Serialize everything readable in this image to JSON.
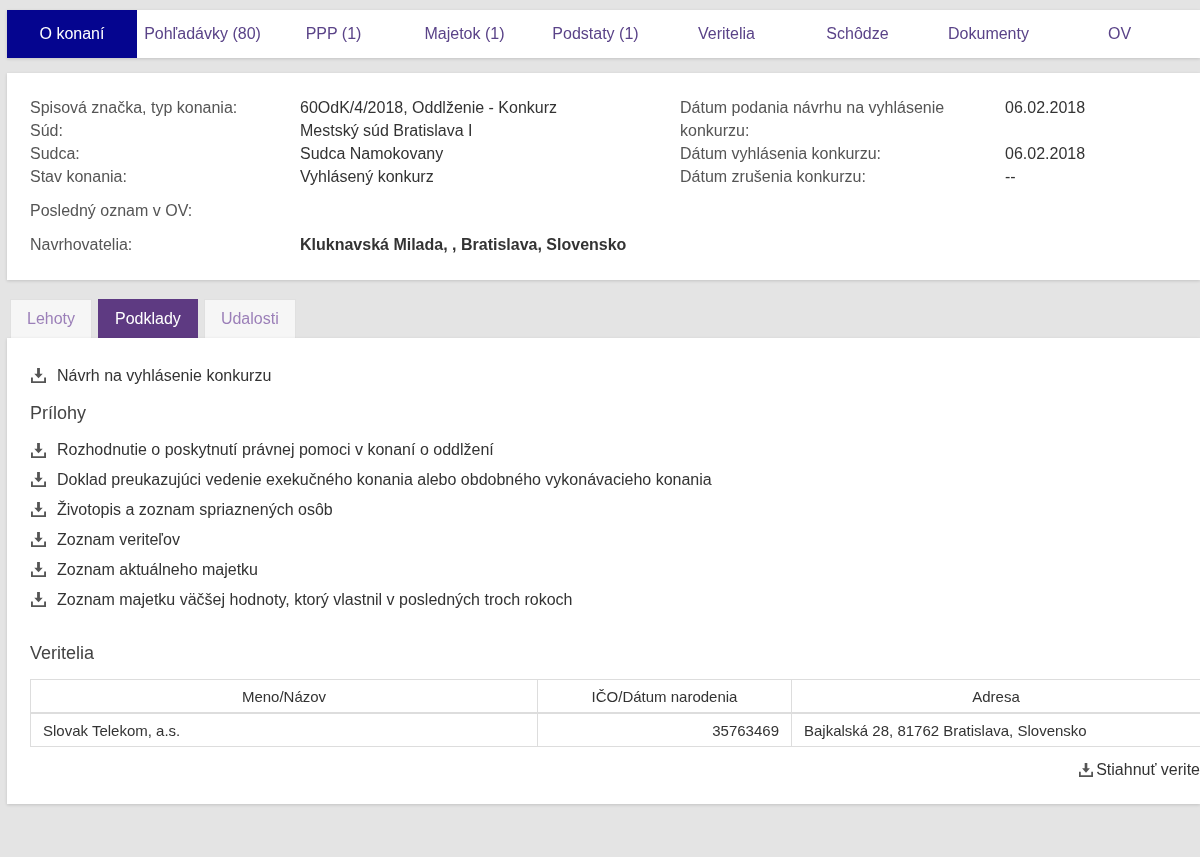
{
  "nav_tabs": [
    {
      "label": "O konaní",
      "selected": true
    },
    {
      "label": "Pohľadávky (80)",
      "selected": false
    },
    {
      "label": "PPP (1)",
      "selected": false
    },
    {
      "label": "Majetok (1)",
      "selected": false
    },
    {
      "label": "Podstaty (1)",
      "selected": false
    },
    {
      "label": "Veritelia",
      "selected": false
    },
    {
      "label": "Schôdze",
      "selected": false
    },
    {
      "label": "Dokumenty",
      "selected": false
    },
    {
      "label": "OV",
      "selected": false
    }
  ],
  "case_info": {
    "left": [
      {
        "label": "Spisová značka, typ konania:",
        "value": "60OdK/4/2018, Oddlženie - Konkurz"
      },
      {
        "label": "Súd:",
        "value": "Mestský súd Bratislava I"
      },
      {
        "label": "Sudca:",
        "value": "Sudca Namokovany"
      },
      {
        "label": "Stav konania:",
        "value": "Vyhlásený konkurz"
      }
    ],
    "right": [
      {
        "label": "Dátum podania návrhu na vyhlásenie konkurzu:",
        "value": "06.02.2018"
      },
      {
        "label": "Dátum vyhlásenia konkurzu:",
        "value": "06.02.2018"
      },
      {
        "label": "Dátum zrušenia konkurzu:",
        "value": "--"
      }
    ],
    "extra_rows": [
      {
        "label": "Posledný oznam v OV:"
      },
      {
        "label": "Navrhovatelia:",
        "value": "Kluknavská Milada, , Bratislava, Slovensko"
      }
    ]
  },
  "section_tabs": [
    {
      "label": "Lehoty",
      "selected": false
    },
    {
      "label": "Podklady",
      "selected": true
    },
    {
      "label": "Udalosti",
      "selected": false
    }
  ],
  "documents": {
    "main": [
      "Návrh na vyhlásenie konkurzu"
    ],
    "attachments_title": "Prílohy",
    "attachments": [
      "Rozhodnutie o poskytnutí právnej pomoci v konaní o oddlžení",
      "Doklad preukazujúci vedenie exekučného konania alebo obdobného vykonávacieho konania",
      "Životopis a zoznam spriaznených osôb",
      "Zoznam veriteľov",
      "Zoznam aktuálneho majetku",
      "Zoznam majetku väčšej hodnoty, ktorý vlastnil v posledných troch rokoch"
    ]
  },
  "creditors": {
    "title": "Veritelia",
    "table": {
      "columns": [
        "Meno/Názov",
        "IČO/Dátum narodenia",
        "Adresa"
      ],
      "rows": [
        [
          "Slovak Telekom, a.s.",
          "35763469",
          "Bajkalská 28, 81762 Bratislava, Slovensko"
        ]
      ]
    },
    "download_link": "Stiahnuť verite"
  }
}
